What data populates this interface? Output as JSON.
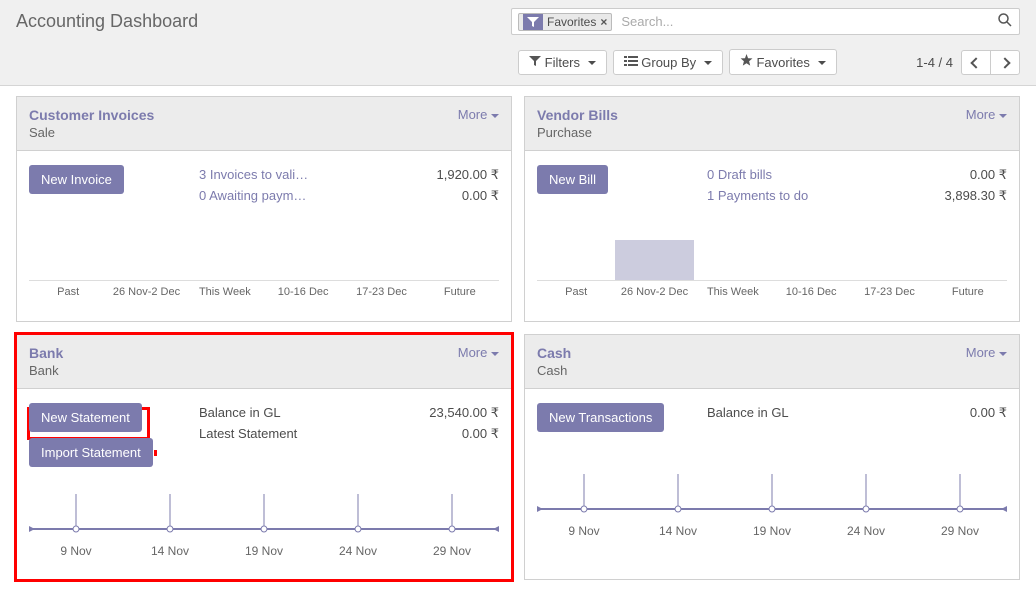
{
  "header": {
    "title": "Accounting Dashboard",
    "facet_label": "Favorites",
    "search_placeholder": "Search...",
    "filters_label": "Filters",
    "groupby_label": "Group By",
    "favorites_label": "Favorites",
    "pager_text": "1-4 / 4"
  },
  "cards": {
    "customer_invoices": {
      "title": "Customer Invoices",
      "subtitle": "Sale",
      "more": "More",
      "action": "New Invoice",
      "link1": "3 Invoices to vali…",
      "link2": "0 Awaiting paym…",
      "val1": "1,920.00 ₹",
      "val2": "0.00 ₹"
    },
    "vendor_bills": {
      "title": "Vendor Bills",
      "subtitle": "Purchase",
      "more": "More",
      "action": "New Bill",
      "link1": "0 Draft bills",
      "link2": "1 Payments to do",
      "val1": "0.00 ₹",
      "val2": "3,898.30 ₹"
    },
    "bank": {
      "title": "Bank",
      "subtitle": "Bank",
      "more": "More",
      "action1": "New Statement",
      "action2": "Import Statement",
      "label1": "Balance in GL",
      "label2": "Latest Statement",
      "val1": "23,540.00 ₹",
      "val2": "0.00 ₹"
    },
    "cash": {
      "title": "Cash",
      "subtitle": "Cash",
      "more": "More",
      "action": "New Transactions",
      "label1": "Balance in GL",
      "val1": "0.00 ₹"
    }
  },
  "chart_data": [
    {
      "type": "bar",
      "owner": "customer_invoices",
      "categories": [
        "Past",
        "26 Nov-2 Dec",
        "This Week",
        "10-16 Dec",
        "17-23 Dec",
        "Future"
      ],
      "values": [
        0,
        0,
        0,
        0,
        0,
        0
      ],
      "ylim": [
        0,
        100
      ]
    },
    {
      "type": "bar",
      "owner": "vendor_bills",
      "categories": [
        "Past",
        "26 Nov-2 Dec",
        "This Week",
        "10-16 Dec",
        "17-23 Dec",
        "Future"
      ],
      "values": [
        0,
        80,
        0,
        0,
        0,
        0
      ],
      "ylim": [
        0,
        100
      ]
    },
    {
      "type": "line",
      "owner": "bank",
      "categories": [
        "9 Nov",
        "14 Nov",
        "19 Nov",
        "24 Nov",
        "29 Nov"
      ],
      "values": [
        0,
        0,
        0,
        0,
        0
      ]
    },
    {
      "type": "line",
      "owner": "cash",
      "categories": [
        "9 Nov",
        "14 Nov",
        "19 Nov",
        "24 Nov",
        "29 Nov"
      ],
      "values": [
        0,
        0,
        0,
        0,
        0
      ]
    }
  ]
}
